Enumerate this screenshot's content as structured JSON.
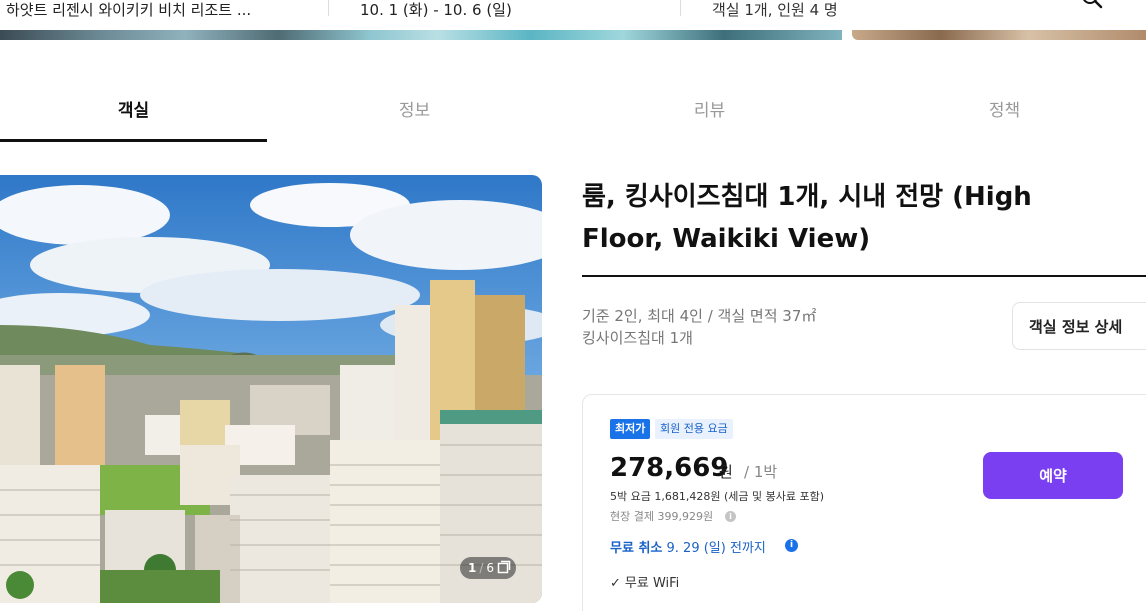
{
  "search": {
    "hotel": "하얏트 리젠시 와이키키 비치 리조트 ...",
    "dates": "10. 1 (화) - 10. 6 (일)",
    "guests": "객실 1개, 인원 4 명",
    "search_icon": "search-icon"
  },
  "tabs": [
    {
      "label": "객실",
      "active": true
    },
    {
      "label": "정보",
      "active": false
    },
    {
      "label": "리뷰",
      "active": false
    },
    {
      "label": "정책",
      "active": false
    }
  ],
  "photo": {
    "current": "1",
    "separator": "/",
    "total": "6",
    "gallery_icon": "gallery-icon"
  },
  "room": {
    "title": "룸, 킹사이즈침대 1개, 시내 전망 (High Floor, Waikiki View)",
    "capacity": "기준 2인, 최대 4인 / 객실 면적 37㎡",
    "bed": "킹사이즈침대 1개",
    "detail_button": "객실 정보 상세"
  },
  "offer": {
    "badge_lowest": "최저가",
    "badge_member": "회원 전용 요금",
    "price": "278,669",
    "price_unit": "원",
    "per_night": "/ 1박",
    "total": "5박 요금 1,681,428원 (세금 및 봉사료 포함)",
    "onsite": "현장 결제 399,929원",
    "cancel_label": "무료 취소",
    "cancel_until": "9. 29 (일) 전까지",
    "amenity": "무료 WiFi",
    "book_button": "예약",
    "accent_color": "#7b3ff2",
    "badge_color": "#1a72e8"
  }
}
